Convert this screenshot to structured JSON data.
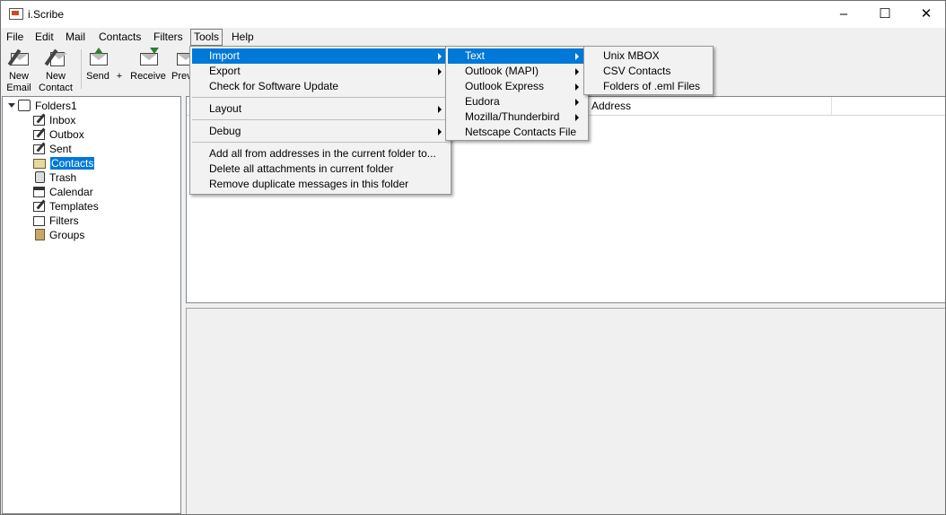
{
  "window": {
    "title": "i.Scribe",
    "minimize": "–",
    "maximize": "☐",
    "close": "✕"
  },
  "menubar": [
    "File",
    "Edit",
    "Mail",
    "Contacts",
    "Filters",
    "Tools",
    "Help"
  ],
  "toolbar": {
    "new_email": [
      "New",
      "Email"
    ],
    "new_contact": [
      "New",
      "Contact"
    ],
    "send": "Send",
    "send_extra": "+",
    "receive": "Receive",
    "preview": "Prev"
  },
  "folders": {
    "root": "Folders1",
    "items": [
      "Inbox",
      "Outbox",
      "Sent",
      "Contacts",
      "Trash",
      "Calendar",
      "Templates",
      "Filters",
      "Groups"
    ],
    "selected": "Contacts"
  },
  "list": {
    "columns": [
      "il Address"
    ]
  },
  "tools_menu": {
    "import": "Import",
    "export": "Export",
    "check_update": "Check for Software Update",
    "layout": "Layout",
    "debug": "Debug",
    "add_all": "Add all from addresses in the current folder to...",
    "delete_attachments": "Delete all attachments in current folder",
    "remove_duplicates": "Remove duplicate messages in this folder"
  },
  "import_menu": {
    "text": "Text",
    "outlook_mapi": "Outlook (MAPI)",
    "outlook_express": "Outlook Express",
    "eudora": "Eudora",
    "mozilla": "Mozilla/Thunderbird",
    "netscape": "Netscape Contacts File"
  },
  "text_menu": {
    "unix_mbox": "Unix MBOX",
    "csv_contacts": "CSV Contacts",
    "eml_folders": "Folders of .eml Files"
  },
  "colors": {
    "highlight": "#0078d7",
    "menu_bg": "#f2f2f2"
  }
}
